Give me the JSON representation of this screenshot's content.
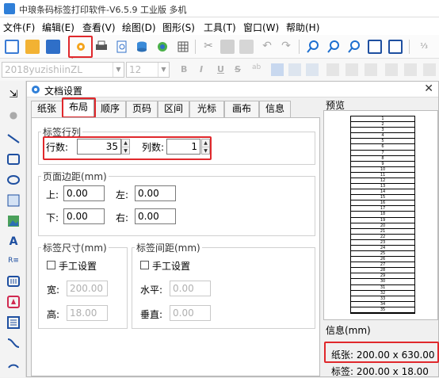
{
  "app": {
    "title": "中琅条码标签打印软件-V6.5.9 工业版 多机"
  },
  "menu": [
    "文件(F)",
    "编辑(E)",
    "查看(V)",
    "绘图(D)",
    "图形(S)",
    "工具(T)",
    "窗口(W)",
    "帮助(H)"
  ],
  "format_bar": {
    "font_name": "2018yuzishiinZL",
    "font_size": "12",
    "bold": "B",
    "italic": "I",
    "underline": "U",
    "strike": "S"
  },
  "dialog": {
    "title": "文档设置",
    "tabs": [
      "纸张",
      "布局",
      "顺序",
      "页码",
      "区间",
      "光标",
      "画布",
      "信息"
    ],
    "active_tab": "布局",
    "rows_cols": {
      "group_label": "标签行列",
      "rows_label": "行数:",
      "rows_value": "35",
      "cols_label": "列数:",
      "cols_value": "1"
    },
    "margins": {
      "group_label": "页面边距(mm)",
      "top_label": "上:",
      "top": "0.00",
      "left_label": "左:",
      "left": "0.00",
      "bottom_label": "下:",
      "bottom": "0.00",
      "right_label": "右:",
      "right": "0.00"
    },
    "label_size": {
      "group_label": "标签尺寸(mm)",
      "manual_label": "手工设置",
      "width_label": "宽:",
      "width": "200.00",
      "height_label": "高:",
      "height": "18.00"
    },
    "label_gap": {
      "group_label": "标签间距(mm)",
      "manual_label": "手工设置",
      "h_label": "水平:",
      "h": "0.00",
      "v_label": "垂直:",
      "v": "0.00"
    },
    "preview_label": "预览",
    "info_label": "信息(mm)",
    "paper_info": "纸张: 200.00 x 630.00",
    "label_info": "标签: 200.00 x 18.00"
  },
  "preview_rows": [
    "1",
    "2",
    "3",
    "4",
    "5",
    "6",
    "7",
    "8",
    "9",
    "10",
    "11",
    "12",
    "13",
    "14",
    "15",
    "16",
    "17",
    "18",
    "19",
    "20",
    "21",
    "22",
    "23",
    "24",
    "25",
    "26",
    "27",
    "28",
    "29",
    "30",
    "31",
    "32",
    "33",
    "34",
    "35"
  ],
  "colors": {
    "highlight": "#e0282c",
    "accent": "#2f7fd8"
  }
}
